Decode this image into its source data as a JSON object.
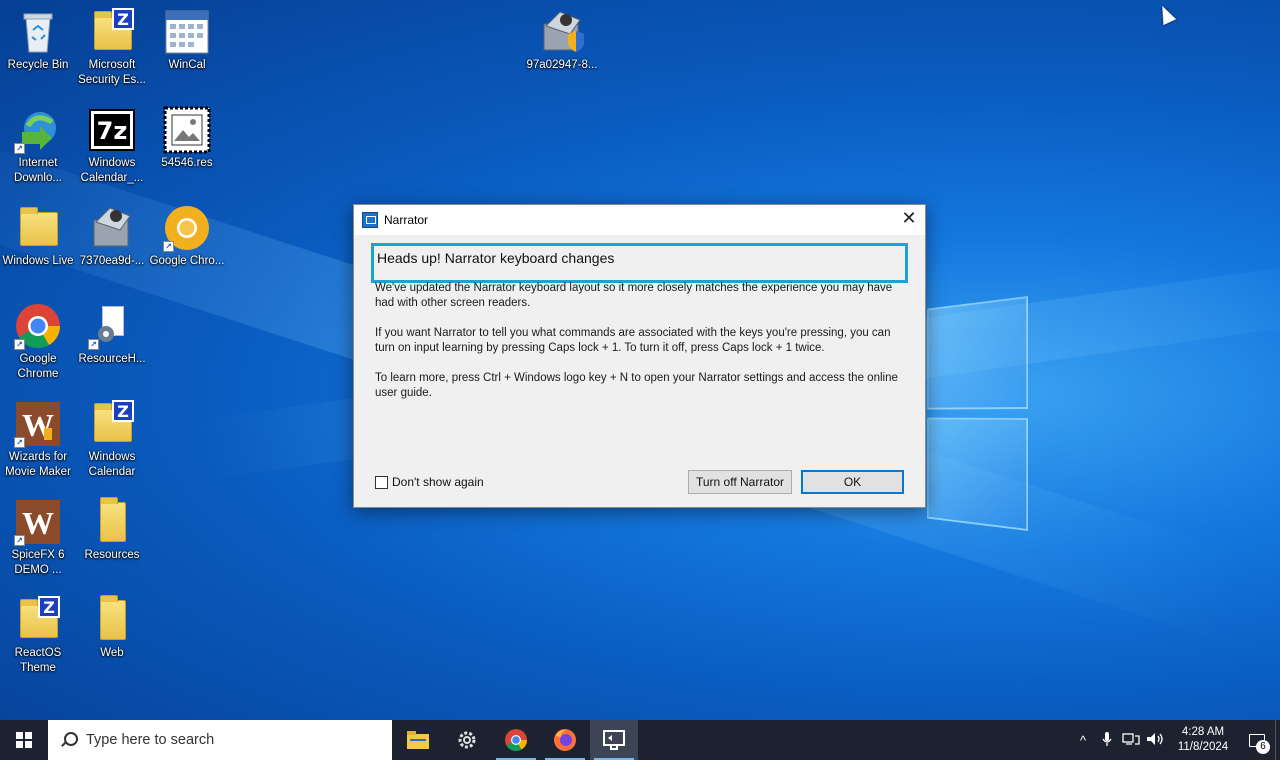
{
  "desktop": {
    "icons": [
      {
        "label": "Recycle Bin",
        "icon": "recycle-bin-icon"
      },
      {
        "label": "Microsoft Security Es...",
        "icon": "zip-folder-icon"
      },
      {
        "label": "WinCal",
        "icon": "calendar-app-icon"
      },
      {
        "label": "97a02947-8...",
        "icon": "installer-shield-icon"
      },
      {
        "label": "Internet Downlo...",
        "icon": "internet-download-manager-icon"
      },
      {
        "label": "Windows Calendar_...",
        "icon": "7zip-archive-icon"
      },
      {
        "label": "54546.res",
        "icon": "image-file-icon"
      },
      {
        "label": "Windows Live",
        "icon": "folder-icon"
      },
      {
        "label": "7370ea9d-...",
        "icon": "installer-icon"
      },
      {
        "label": "Google Chro...",
        "icon": "chrome-canary-icon"
      },
      {
        "label": "Google Chrome",
        "icon": "chrome-icon"
      },
      {
        "label": "ResourceH...",
        "icon": "settings-file-icon"
      },
      {
        "label": "Wizards for Movie Maker",
        "icon": "wizards-app-icon"
      },
      {
        "label": "Windows Calendar",
        "icon": "zip-folder-icon"
      },
      {
        "label": "SpiceFX 6 DEMO ...",
        "icon": "spicefx-app-icon"
      },
      {
        "label": "Resources",
        "icon": "folder-icon"
      },
      {
        "label": "ReactOS Theme",
        "icon": "zip-folder-icon"
      },
      {
        "label": "Web",
        "icon": "folder-icon"
      }
    ]
  },
  "dialog": {
    "title": "Narrator",
    "close_symbol": "✕",
    "heading": "Heads up! Narrator keyboard changes",
    "para1": "We've updated the Narrator keyboard layout so it more closely matches the experience you may have had with other screen readers.",
    "para2": "If you want Narrator to tell you what commands are associated with the keys you're pressing, you can turn on input learning by pressing Caps lock + 1. To turn it off, press Caps lock + 1 twice.",
    "para3": "To learn more, press Ctrl + Windows logo key + N to open your Narrator settings and access the online user guide.",
    "checkbox_label": "Don't show again",
    "checkbox_checked": false,
    "turn_off_button": "Turn off Narrator",
    "ok_button": "OK"
  },
  "taskbar": {
    "search_placeholder": "Type here to search",
    "apps": [
      "file-explorer-icon",
      "settings-gear-icon",
      "chrome-icon",
      "firefox-icon",
      "narrator-icon"
    ],
    "time": "4:28 AM",
    "date": "11/8/2024",
    "notification_count": "6"
  }
}
